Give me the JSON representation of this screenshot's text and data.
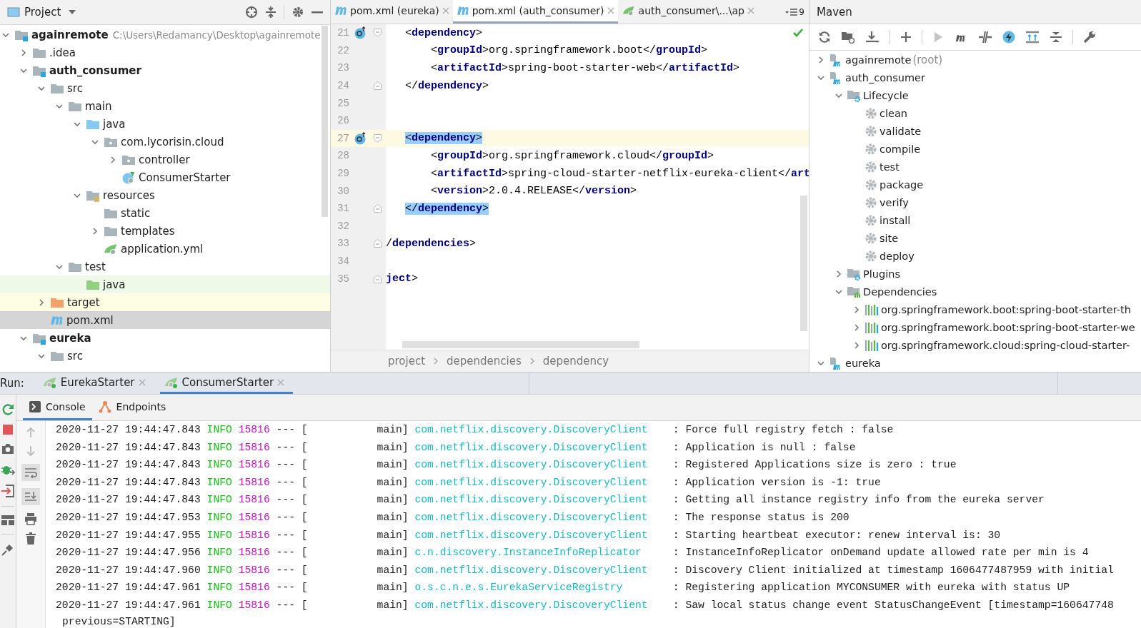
{
  "project_panel": {
    "title": "Project",
    "tree": [
      {
        "label": "againremote",
        "kind": "module",
        "detail": "C:\\Users\\Redamancy\\Desktop\\againremote",
        "expanded": true,
        "selected": false,
        "children": [
          {
            "label": ".idea",
            "kind": "folder",
            "expanded": false,
            "selected": false
          },
          {
            "label": "auth_consumer",
            "kind": "module",
            "expanded": true,
            "selected": false,
            "children": [
              {
                "label": "src",
                "kind": "folder",
                "expanded": true,
                "selected": false,
                "children": [
                  {
                    "label": "main",
                    "kind": "folder",
                    "expanded": true,
                    "selected": false,
                    "children": [
                      {
                        "label": "java",
                        "kind": "source-root",
                        "expanded": true,
                        "selected": false,
                        "children": [
                          {
                            "label": "com.lycorisin.cloud",
                            "kind": "package",
                            "expanded": true,
                            "selected": false,
                            "children": [
                              {
                                "label": "controller",
                                "kind": "package",
                                "expanded": false,
                                "selected": false
                              },
                              {
                                "label": "ConsumerStarter",
                                "kind": "spring-class",
                                "selected": false
                              }
                            ]
                          }
                        ]
                      },
                      {
                        "label": "resources",
                        "kind": "resources-root",
                        "expanded": true,
                        "selected": false,
                        "children": [
                          {
                            "label": "static",
                            "kind": "folder",
                            "selected": false
                          },
                          {
                            "label": "templates",
                            "kind": "folder",
                            "expanded": false,
                            "selected": false
                          },
                          {
                            "label": "application.yml",
                            "kind": "spring-config",
                            "selected": false
                          }
                        ]
                      }
                    ]
                  },
                  {
                    "label": "test",
                    "kind": "folder",
                    "expanded": true,
                    "selected": false,
                    "children": [
                      {
                        "label": "java",
                        "kind": "test-root",
                        "selected": false
                      }
                    ]
                  }
                ]
              },
              {
                "label": "target",
                "kind": "excluded",
                "expanded": false,
                "selected": false
              },
              {
                "label": "pom.xml",
                "kind": "maven",
                "selected": true
              }
            ]
          },
          {
            "label": "eureka",
            "kind": "module",
            "expanded": true,
            "selected": false,
            "children": [
              {
                "label": "src",
                "kind": "folder",
                "expanded": true,
                "selected": false
              }
            ]
          }
        ]
      }
    ]
  },
  "editor": {
    "tabs": [
      {
        "label": "pom.xml (eureka)",
        "kind": "maven",
        "selected": false
      },
      {
        "label": "pom.xml (auth_consumer)",
        "kind": "maven",
        "selected": true
      },
      {
        "label": "auth_consumer\\...\\ap",
        "kind": "spring",
        "selected": false
      }
    ],
    "tab_overflow_count": "9",
    "lines": [
      {
        "number": "21",
        "marker": true,
        "fold_open": true,
        "parts": [
          {
            "kind": "plain",
            "text": "   <"
          },
          {
            "kind": "tag",
            "text": "dependency"
          },
          {
            "kind": "plain",
            "text": ">"
          }
        ]
      },
      {
        "number": "22",
        "parts": [
          {
            "kind": "plain",
            "text": "       <"
          },
          {
            "kind": "tag",
            "text": "groupId"
          },
          {
            "kind": "plain",
            "text": ">org.springframework.boot</"
          },
          {
            "kind": "tag",
            "text": "groupId"
          },
          {
            "kind": "plain",
            "text": ">"
          }
        ]
      },
      {
        "number": "23",
        "parts": [
          {
            "kind": "plain",
            "text": "       <"
          },
          {
            "kind": "tag",
            "text": "artifactId"
          },
          {
            "kind": "plain",
            "text": ">spring-boot-starter-web</"
          },
          {
            "kind": "tag",
            "text": "artifactId"
          },
          {
            "kind": "plain",
            "text": ">"
          }
        ]
      },
      {
        "number": "24",
        "fold_close": true,
        "parts": [
          {
            "kind": "plain",
            "text": "   </"
          },
          {
            "kind": "tag",
            "text": "dependency"
          },
          {
            "kind": "plain",
            "text": ">"
          }
        ]
      },
      {
        "number": "25"
      },
      {
        "number": "26"
      },
      {
        "number": "27",
        "marker": true,
        "fold_open": true,
        "current": true,
        "matched": true,
        "parts": [
          {
            "kind": "plain",
            "text": "   <"
          },
          {
            "kind": "tag",
            "text": "dependency"
          },
          {
            "kind": "plain",
            "text": ">"
          }
        ]
      },
      {
        "number": "28",
        "parts": [
          {
            "kind": "plain",
            "text": "       <"
          },
          {
            "kind": "tag",
            "text": "groupId"
          },
          {
            "kind": "plain",
            "text": ">org.springframework.cloud</"
          },
          {
            "kind": "tag",
            "text": "groupId"
          },
          {
            "kind": "plain",
            "text": ">"
          }
        ]
      },
      {
        "number": "29",
        "parts": [
          {
            "kind": "plain",
            "text": "       <"
          },
          {
            "kind": "tag",
            "text": "artifactId"
          },
          {
            "kind": "plain",
            "text": ">spring-cloud-starter-netflix-eureka-client</"
          },
          {
            "kind": "tag",
            "text": "art"
          }
        ]
      },
      {
        "number": "30",
        "parts": [
          {
            "kind": "plain",
            "text": "       <"
          },
          {
            "kind": "tag",
            "text": "version"
          },
          {
            "kind": "plain",
            "text": ">2.0.4.RELEASE</"
          },
          {
            "kind": "tag",
            "text": "version"
          },
          {
            "kind": "plain",
            "text": ">"
          }
        ]
      },
      {
        "number": "31",
        "fold_close": true,
        "matched": true,
        "parts": [
          {
            "kind": "plain",
            "text": "   </"
          },
          {
            "kind": "tag",
            "text": "dependency"
          },
          {
            "kind": "plain",
            "text": ">"
          }
        ]
      },
      {
        "number": "32"
      },
      {
        "number": "33",
        "fold_close": true,
        "parts": [
          {
            "kind": "plain",
            "text": "/"
          },
          {
            "kind": "tag",
            "text": "dependencies"
          },
          {
            "kind": "plain",
            "text": ">"
          }
        ]
      },
      {
        "number": "34"
      },
      {
        "number": "35",
        "fold_close": true,
        "parts": [
          {
            "kind": "tag",
            "text": "ject"
          },
          {
            "kind": "plain",
            "text": ">"
          }
        ]
      }
    ],
    "breadcrumb": [
      "project",
      "dependencies",
      "dependency"
    ]
  },
  "maven_panel": {
    "title": "Maven",
    "tree": [
      {
        "label": "againremote",
        "note": "(root)",
        "kind": "maven-module",
        "expanded": false
      },
      {
        "label": "auth_consumer",
        "kind": "maven-module",
        "expanded": true,
        "children": [
          {
            "label": "Lifecycle",
            "kind": "lifecycle",
            "expanded": true,
            "children": [
              {
                "label": "clean",
                "kind": "goal"
              },
              {
                "label": "validate",
                "kind": "goal"
              },
              {
                "label": "compile",
                "kind": "goal"
              },
              {
                "label": "test",
                "kind": "goal"
              },
              {
                "label": "package",
                "kind": "goal"
              },
              {
                "label": "verify",
                "kind": "goal"
              },
              {
                "label": "install",
                "kind": "goal"
              },
              {
                "label": "site",
                "kind": "goal"
              },
              {
                "label": "deploy",
                "kind": "goal"
              }
            ]
          },
          {
            "label": "Plugins",
            "kind": "plugins",
            "expanded": false
          },
          {
            "label": "Dependencies",
            "kind": "dependencies",
            "expanded": true,
            "children": [
              {
                "label": "org.springframework.boot:spring-boot-starter-th",
                "kind": "dependency",
                "expanded": false
              },
              {
                "label": "org.springframework.boot:spring-boot-starter-we",
                "kind": "dependency",
                "expanded": false
              },
              {
                "label": "org.springframework.cloud:spring-cloud-starter-",
                "kind": "dependency",
                "expanded": false
              }
            ]
          }
        ]
      },
      {
        "label": "eureka",
        "kind": "maven-module",
        "expanded": true
      }
    ]
  },
  "run_panel": {
    "label": "Run:",
    "tabs": [
      {
        "label": "EurekaStarter",
        "selected": false
      },
      {
        "label": "ConsumerStarter",
        "selected": true
      }
    ],
    "subtabs": [
      {
        "label": "Console",
        "kind": "console",
        "selected": true
      },
      {
        "label": "Endpoints",
        "kind": "endpoints",
        "selected": false
      }
    ],
    "console": [
      {
        "kind": "log",
        "time": "2020-11-27 19:44:47.843",
        "level": "INFO",
        "pid": "15816",
        "thread": "--- [           main]",
        "logger": "com.netflix.discovery.DiscoveryClient",
        "message": ": Force full registry fetch : false"
      },
      {
        "kind": "log",
        "time": "2020-11-27 19:44:47.843",
        "level": "INFO",
        "pid": "15816",
        "thread": "--- [           main]",
        "logger": "com.netflix.discovery.DiscoveryClient",
        "message": ": Application is null : false"
      },
      {
        "kind": "log",
        "time": "2020-11-27 19:44:47.843",
        "level": "INFO",
        "pid": "15816",
        "thread": "--- [           main]",
        "logger": "com.netflix.discovery.DiscoveryClient",
        "message": ": Registered Applications size is zero : true"
      },
      {
        "kind": "log",
        "time": "2020-11-27 19:44:47.843",
        "level": "INFO",
        "pid": "15816",
        "thread": "--- [           main]",
        "logger": "com.netflix.discovery.DiscoveryClient",
        "message": ": Application version is -1: true"
      },
      {
        "kind": "log",
        "time": "2020-11-27 19:44:47.843",
        "level": "INFO",
        "pid": "15816",
        "thread": "--- [           main]",
        "logger": "com.netflix.discovery.DiscoveryClient",
        "message": ": Getting all instance registry info from the eureka server"
      },
      {
        "kind": "log",
        "time": "2020-11-27 19:44:47.953",
        "level": "INFO",
        "pid": "15816",
        "thread": "--- [           main]",
        "logger": "com.netflix.discovery.DiscoveryClient",
        "message": ": The response status is 200"
      },
      {
        "kind": "log",
        "time": "2020-11-27 19:44:47.955",
        "level": "INFO",
        "pid": "15816",
        "thread": "--- [           main]",
        "logger": "com.netflix.discovery.DiscoveryClient",
        "message": ": Starting heartbeat executor: renew interval is: 30"
      },
      {
        "kind": "log",
        "time": "2020-11-27 19:44:47.956",
        "level": "INFO",
        "pid": "15816",
        "thread": "--- [           main]",
        "logger": "c.n.discovery.InstanceInfoReplicator",
        "message": ": InstanceInfoReplicator onDemand update allowed rate per min is 4"
      },
      {
        "kind": "log",
        "time": "2020-11-27 19:44:47.960",
        "level": "INFO",
        "pid": "15816",
        "thread": "--- [           main]",
        "logger": "com.netflix.discovery.DiscoveryClient",
        "message": ": Discovery Client initialized at timestamp 1606477487959 with initial"
      },
      {
        "kind": "log",
        "time": "2020-11-27 19:44:47.961",
        "level": "INFO",
        "pid": "15816",
        "thread": "--- [           main]",
        "logger": "o.s.c.n.e.s.EurekaServiceRegistry",
        "message": ": Registering application MYCONSUMER with eureka with status UP"
      },
      {
        "kind": "log",
        "time": "2020-11-27 19:44:47.961",
        "level": "INFO",
        "pid": "15816",
        "thread": "--- [           main]",
        "logger": "com.netflix.discovery.DiscoveryClient",
        "message": ": Saw local status change event StatusChangeEvent [timestamp=160647748"
      },
      {
        "kind": "wrap",
        "text": "previous=STARTING]"
      }
    ]
  }
}
